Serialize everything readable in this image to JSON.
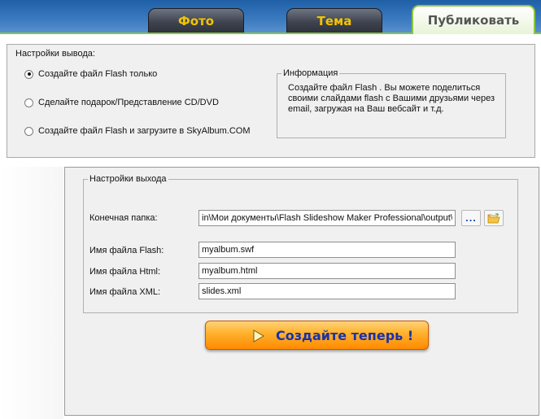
{
  "tabs": [
    {
      "label": "Фото"
    },
    {
      "label": "Тема"
    },
    {
      "label": "Публиковать",
      "active": true
    }
  ],
  "output_options": {
    "legend": "Настройки вывода:",
    "options": [
      {
        "label": "Создайте файл Flash только",
        "checked": true
      },
      {
        "label": "Сделайте подарок/Представление CD/DVD",
        "checked": false
      },
      {
        "label": "Создайте файл Flash и загрузите в SkyAlbum.COM",
        "checked": false
      }
    ]
  },
  "info": {
    "title": "Информация",
    "text": "Создайте файл Flash . Вы можете поделиться своими слайдами flash с Вашими друзьями через email, загружая на Ваш вебсайт и т.д."
  },
  "output_settings": {
    "legend": "Настройки выхода",
    "folder_label": "Конечная папка:",
    "folder_value": "in\\Мои документы\\Flash Slideshow Maker Professional\\output\\",
    "browse_label": "...",
    "flash_label": "Имя файла Flash:",
    "flash_value": "myalbum.swf",
    "html_label": "Имя файла Html:",
    "html_value": "myalbum.html",
    "xml_label": "Имя файла XML:",
    "xml_value": "slides.xml"
  },
  "create_button": {
    "label": "Создайте теперь !"
  },
  "icons": {
    "play": "play-icon",
    "folder": "folder-icon",
    "browse": "dots-icon"
  },
  "colors": {
    "accent_green": "#8cc63e",
    "tab_text": "#f3c400",
    "button_orange": "#ff9a1a",
    "button_text": "#1932a8"
  }
}
